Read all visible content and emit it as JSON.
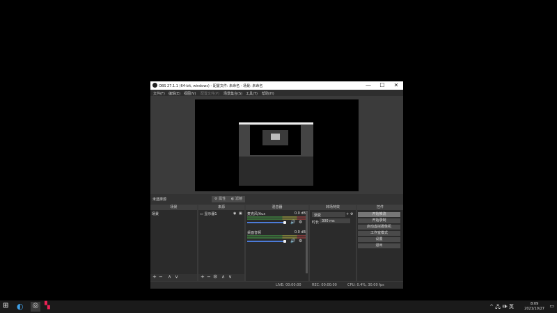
{
  "window": {
    "title": "OBS 27.1.1 (64-bit, windows) - 配置文件: 未命名 - 场景: 未命名",
    "minimize": "—",
    "maximize": "☐",
    "close": "✕"
  },
  "menu": [
    "文件(F)",
    "编辑(E)",
    "视图(V)",
    "配置文件(P)",
    "场景集合(S)",
    "工具(T)",
    "帮助(H)"
  ],
  "context_bar": {
    "no_source": "未选择源",
    "properties": "属性",
    "filters": "滤镜"
  },
  "docks": {
    "scenes": {
      "title": "场景",
      "items": [
        "场景"
      ]
    },
    "sources": {
      "title": "来源",
      "items": [
        "显示器1"
      ]
    },
    "mixer": {
      "title": "混音器",
      "channels": [
        {
          "name": "麦克风/Aux",
          "level": "0.0 dB"
        },
        {
          "name": "桌面音频",
          "level": "0.0 dB"
        }
      ]
    },
    "transitions": {
      "title": "转场特效",
      "type": "渐变",
      "duration_label": "时长",
      "duration": "300 ms"
    },
    "controls": {
      "title": "控件",
      "buttons": [
        "开始推流",
        "开始录制",
        "启动虚拟摄像机",
        "工作室模式",
        "设置",
        "退出"
      ]
    }
  },
  "status": {
    "live": "LIVE: 00:00:00",
    "rec": "REC: 00:00:00",
    "cpu": "CPU: 0.4%, 30.00 fps"
  },
  "taskbar": {
    "time": "8:09",
    "date": "2021/10/27",
    "tray": "^ 🖧 🕪 英"
  },
  "colors": {
    "accent": "#4c7bd8",
    "window_bg": "#3a3a3a",
    "dock_bg": "#2b2b2b"
  }
}
